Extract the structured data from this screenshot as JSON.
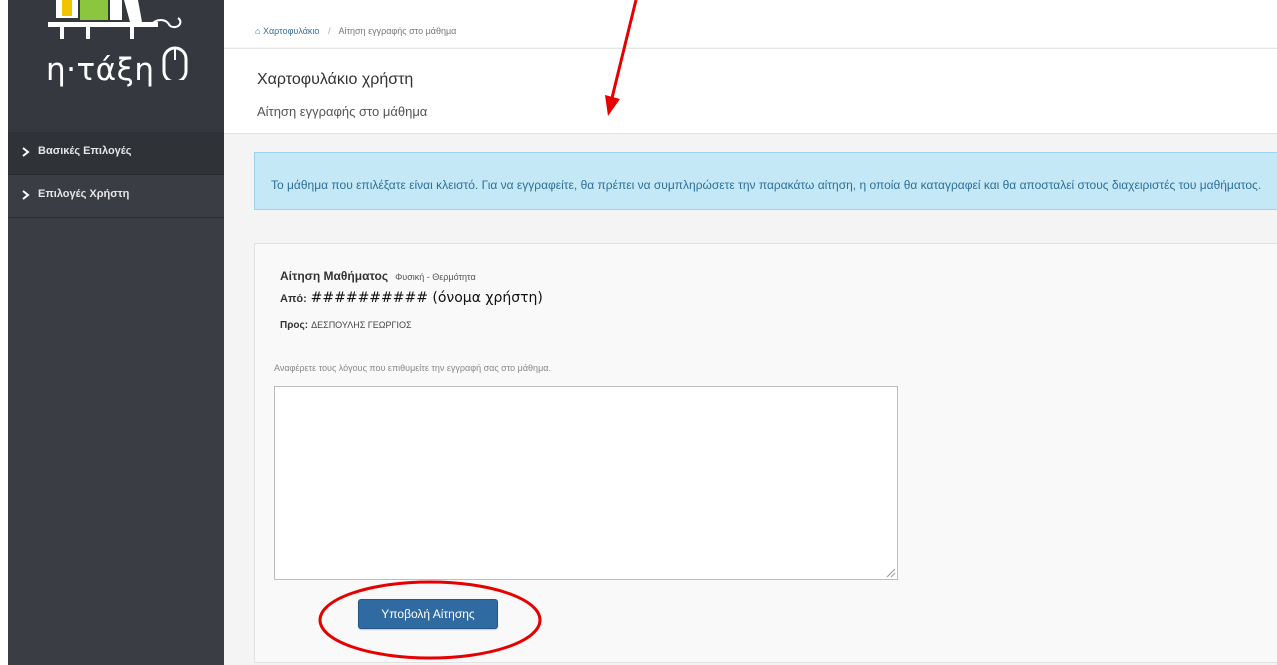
{
  "logo": {
    "text": "η·τάξη"
  },
  "sidebar": {
    "items": [
      {
        "label": "Βασικές Επιλογές"
      },
      {
        "label": "Επιλογές Χρήστη"
      }
    ]
  },
  "breadcrumb": {
    "home": "Χαρτοφυλάκιο",
    "current": "Αίτηση εγγραφής στο μάθημα"
  },
  "header": {
    "title": "Χαρτοφυλάκιο χρήστη",
    "subtitle": "Αίτηση εγγραφής στο μάθημα"
  },
  "alert": {
    "text": "Το μάθημα που επιλέξατε είναι κλειστό. Για να εγγραφείτε, θα πρέπει να συμπληρώσετε την παρακάτω αίτηση, η οποία θα καταγραφεί και θα αποσταλεί στους διαχειριστές του μαθήματος."
  },
  "request": {
    "title_label": "Αίτηση Μαθήματος",
    "course": "Φυσική - Θερμότητα",
    "from_label": "Από:",
    "from_value": "########## (όνομα χρήστη)",
    "to_label": "Προς:",
    "to_value": "ΔΕΣΠΟΥΛΗΣ ΓΕΩΡΓΙΟΣ"
  },
  "form": {
    "hint": "Αναφέρετε τους λόγους που επιθυμείτε την εγγραφή σας στο μάθημα.",
    "textarea_value": "",
    "submit_label": "Υποβολή Αίτησης"
  },
  "colors": {
    "sidebar_bg": "#3a3d44",
    "alert_bg": "#c5e8f6",
    "alert_text": "#2d6f99",
    "button_bg": "#2f6aa0",
    "annotation_red": "#e60000"
  }
}
